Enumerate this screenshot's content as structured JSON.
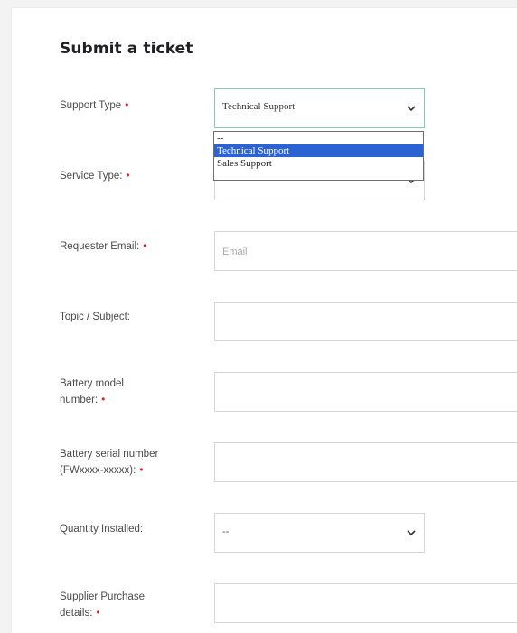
{
  "form": {
    "title": "Submit a ticket",
    "required_marker": "•",
    "fields": {
      "support_type": {
        "label": "Support Type",
        "value": "Technical Support",
        "options": [
          "--",
          "Technical Support",
          "Sales Support"
        ],
        "highlighted_option": "Technical Support"
      },
      "service_type": {
        "label": "Service Type:"
      },
      "requester_email": {
        "label": "Requester Email:",
        "placeholder": "Email"
      },
      "topic_subject": {
        "label": "Topic / Subject:"
      },
      "battery_model": {
        "label_line1": "Battery model",
        "label_line2": "number:"
      },
      "battery_serial": {
        "label_line1": "Battery serial number",
        "label_line2": "(FWxxxx-xxxxx):"
      },
      "quantity_installed": {
        "label": "Quantity Installed:",
        "value": "--"
      },
      "supplier_purchase": {
        "label_line1": "Supplier Purchase",
        "label_line2": "details:"
      }
    }
  },
  "colors": {
    "required": "#e02424",
    "focus_border": "#7fc8bd",
    "option_highlight": "#2c63d4"
  },
  "icons": {
    "select_arrow": "chevron-down-icon"
  }
}
